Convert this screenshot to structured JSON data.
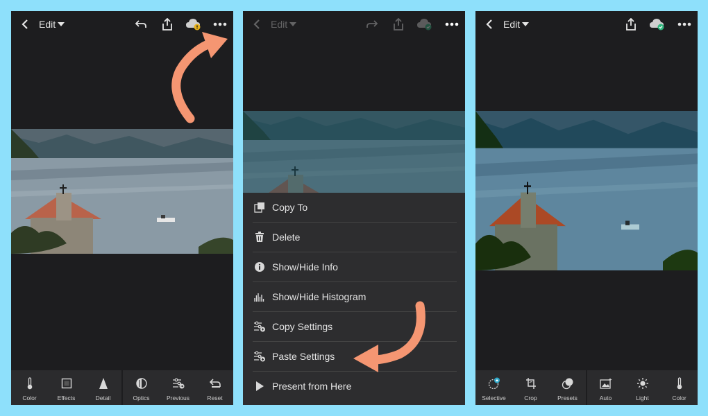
{
  "left_screen": {
    "edit_label": "Edit",
    "tools": [
      {
        "label": "Color",
        "icon": "thermometer-icon"
      },
      {
        "label": "Effects",
        "icon": "effects-icon"
      },
      {
        "label": "Detail",
        "icon": "detail-icon"
      },
      {
        "label": "Optics",
        "icon": "optics-icon"
      },
      {
        "label": "Previous",
        "icon": "previous-icon"
      },
      {
        "label": "Reset",
        "icon": "reset-icon"
      }
    ]
  },
  "middle_screen": {
    "edit_label": "Edit",
    "menu": [
      {
        "label": "Copy To",
        "icon": "copy-to-icon"
      },
      {
        "label": "Delete",
        "icon": "trash-icon"
      },
      {
        "label": "Show/Hide Info",
        "icon": "info-icon"
      },
      {
        "label": "Show/Hide Histogram",
        "icon": "histogram-icon"
      },
      {
        "label": "Copy Settings",
        "icon": "copy-settings-icon"
      },
      {
        "label": "Paste Settings",
        "icon": "paste-settings-icon"
      },
      {
        "label": "Present from Here",
        "icon": "play-icon"
      }
    ]
  },
  "right_screen": {
    "edit_label": "Edit",
    "tools": [
      {
        "label": "Selective",
        "icon": "selective-icon"
      },
      {
        "label": "Crop",
        "icon": "crop-icon"
      },
      {
        "label": "Presets",
        "icon": "presets-icon"
      },
      {
        "label": "Auto",
        "icon": "auto-icon"
      },
      {
        "label": "Light",
        "icon": "sun-icon"
      },
      {
        "label": "Color",
        "icon": "thermometer-icon"
      }
    ]
  },
  "colors": {
    "background": "#8ee0fb",
    "app_dark": "#1d1d1f",
    "arrow": "#f59672",
    "cloud_warning": "#e8b21c",
    "cloud_synced": "#2fb67d"
  }
}
